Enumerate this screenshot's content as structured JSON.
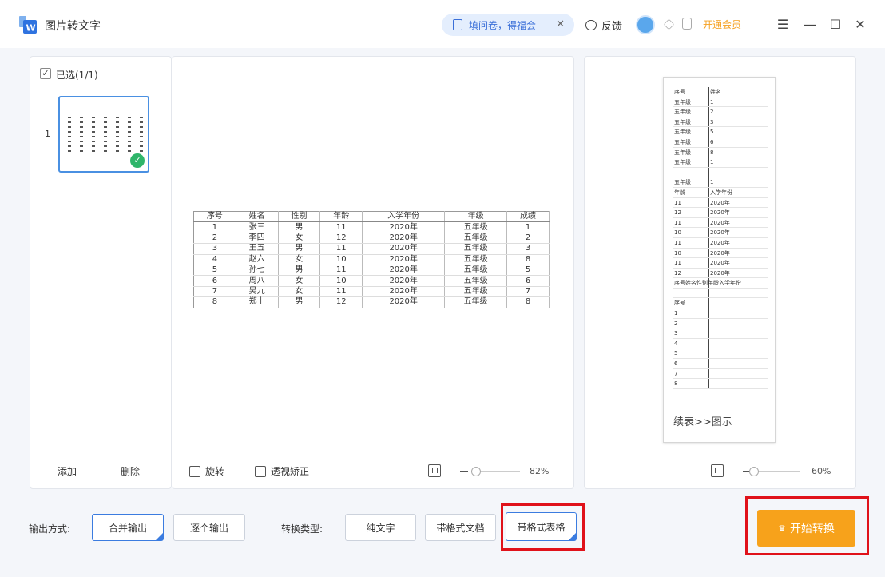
{
  "app": {
    "title": "图片转文字"
  },
  "promo": {
    "label": "填问卷，得福会"
  },
  "header": {
    "feedback": "反馈",
    "vip": "开通会员"
  },
  "thumbs": {
    "selected_label": "已选(1/1)",
    "page_number": "1",
    "add": "添加",
    "delete": "删除"
  },
  "preview": {
    "rotate": "旋转",
    "perspective": "透视矫正",
    "zoom": "82%",
    "table": {
      "headers": [
        "序号",
        "姓名",
        "性别",
        "年龄",
        "入学年份",
        "年级",
        "成绩"
      ],
      "rows": [
        [
          "1",
          "张三",
          "男",
          "11",
          "2020年",
          "五年级",
          "1"
        ],
        [
          "2",
          "李四",
          "女",
          "12",
          "2020年",
          "五年级",
          "2"
        ],
        [
          "3",
          "王五",
          "男",
          "11",
          "2020年",
          "五年级",
          "3"
        ],
        [
          "4",
          "赵六",
          "女",
          "10",
          "2020年",
          "五年级",
          "8"
        ],
        [
          "5",
          "孙七",
          "男",
          "11",
          "2020年",
          "五年级",
          "5"
        ],
        [
          "6",
          "周八",
          "女",
          "10",
          "2020年",
          "五年级",
          "6"
        ],
        [
          "7",
          "吴九",
          "女",
          "11",
          "2020年",
          "五年级",
          "7"
        ],
        [
          "8",
          "郑十",
          "男",
          "12",
          "2020年",
          "五年级",
          "8"
        ]
      ]
    }
  },
  "result": {
    "zoom": "60%",
    "doc_rows": [
      [
        "序号",
        "姓名"
      ],
      [
        "五年级",
        "1"
      ],
      [
        "五年级",
        "2"
      ],
      [
        "五年级",
        "3"
      ],
      [
        "五年级",
        "5"
      ],
      [
        "五年级",
        "6"
      ],
      [
        "五年级",
        "8"
      ],
      [
        "五年级",
        "1"
      ],
      [
        "",
        ""
      ],
      [
        "五年级",
        "1"
      ],
      [
        "年龄",
        "入学年份"
      ],
      [
        "11",
        "2020年"
      ],
      [
        "12",
        "2020年"
      ],
      [
        "11",
        "2020年"
      ],
      [
        "10",
        "2020年"
      ],
      [
        "11",
        "2020年"
      ],
      [
        "10",
        "2020年"
      ],
      [
        "11",
        "2020年"
      ],
      [
        "12",
        "2020年"
      ],
      [
        "序号姓名性别年龄入学年份",
        ""
      ],
      [
        "",
        ""
      ],
      [
        "序号",
        ""
      ],
      [
        "1",
        ""
      ],
      [
        "2",
        ""
      ],
      [
        "3",
        ""
      ],
      [
        "4",
        ""
      ],
      [
        "5",
        ""
      ],
      [
        "6",
        ""
      ],
      [
        "7",
        ""
      ],
      [
        "8",
        ""
      ]
    ],
    "tail": "续表>>图示"
  },
  "bottom": {
    "output_label": "输出方式:",
    "merge": "合并输出",
    "single": "逐个输出",
    "type_label": "转换类型:",
    "plain": "纯文字",
    "doc": "带格式文档",
    "table": "带格式表格",
    "start": "开始转换"
  }
}
